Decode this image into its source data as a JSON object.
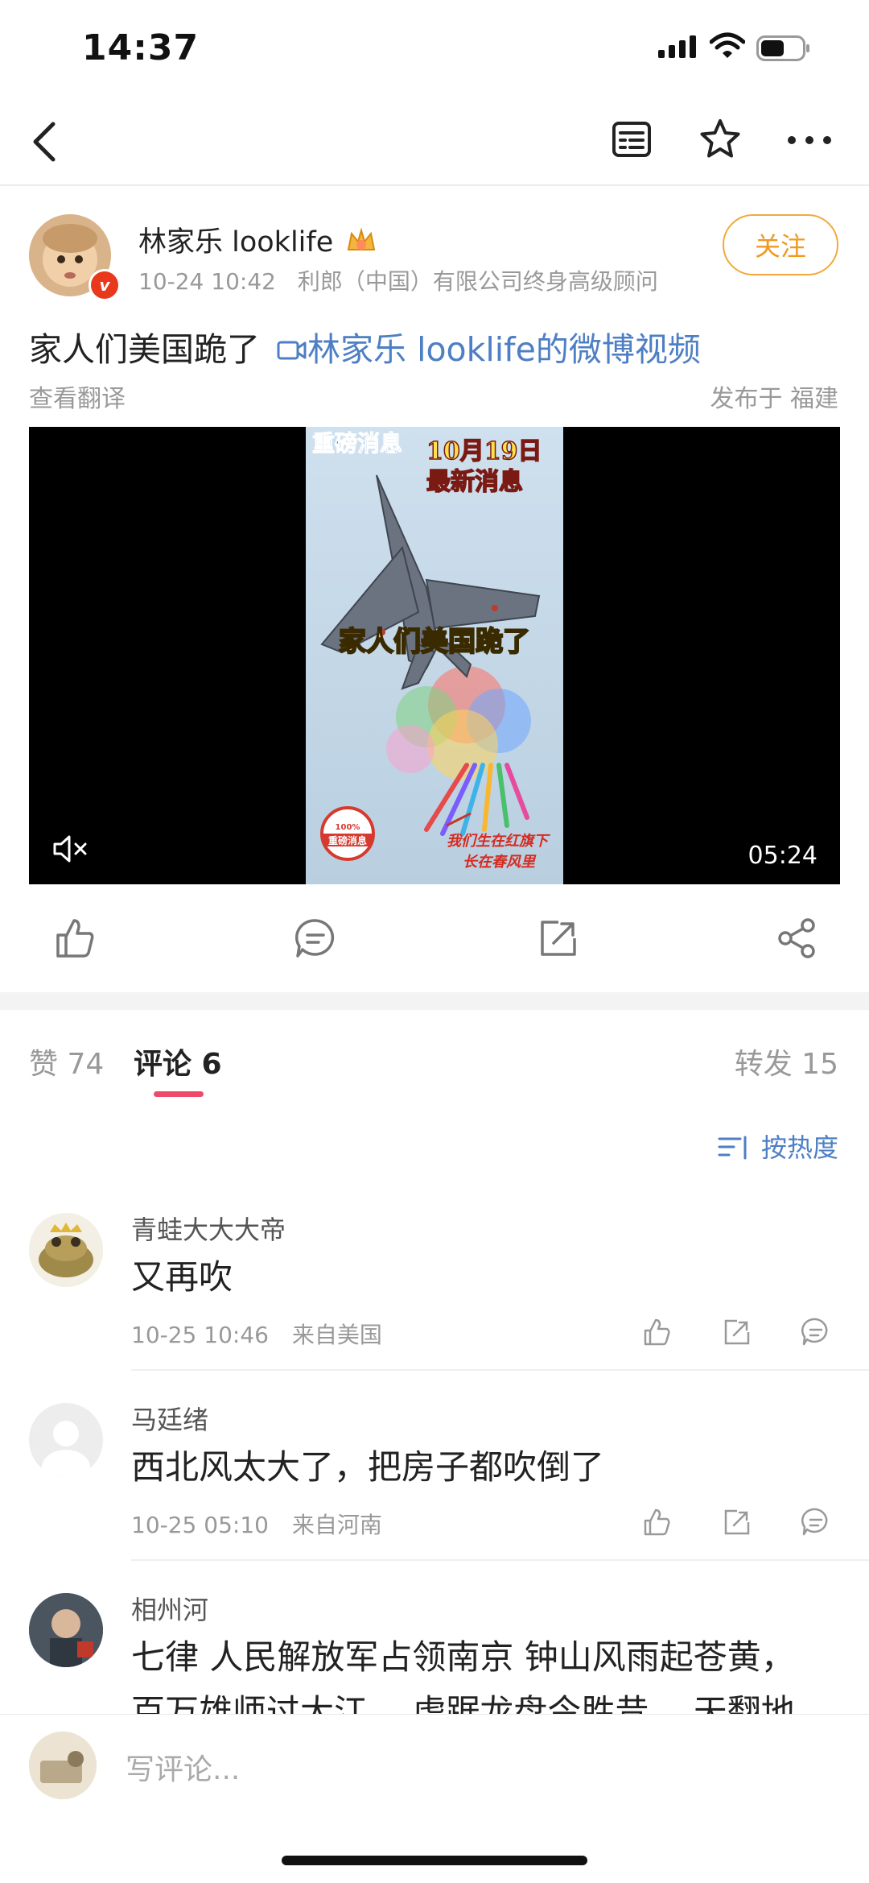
{
  "status_bar": {
    "time": "14:37"
  },
  "post": {
    "author_name": "林家乐 looklife",
    "date": "10-24 10:42",
    "author_title": "利郎（中国）有限公司终身高级顾问",
    "follow_label": "关注",
    "text": "家人们美国跪了",
    "video_link_label": "林家乐 looklife的微博视频",
    "translate_label": "查看翻译",
    "location": "发布于 福建"
  },
  "video": {
    "duration": "05:24",
    "banner_logo": "重磅消息",
    "banner_date": "10月19日",
    "banner_news": "最新消息",
    "caption": "家人们美国跪了",
    "stamp_percent": "100%",
    "stamp_label": "重磅消息",
    "slogan_line1": "我们生在红旗下",
    "slogan_line2": "长在春风里"
  },
  "tabs": {
    "likes": "赞 74",
    "comments": "评论 6",
    "reposts": "转发 15"
  },
  "sort_label": "按热度",
  "comments": [
    {
      "name": "青蛙大大大帝",
      "text": "又再吹",
      "date": "10-25 10:46",
      "location": "来自美国"
    },
    {
      "name": "马廷绪",
      "text": "西北风太大了，把房子都吹倒了",
      "date": "10-25 05:10",
      "location": "来自河南"
    },
    {
      "name": "相州河",
      "text": "七律 人民解放军占领南京 钟山风雨起苍黄，",
      "text2": "百万雄师过大江。 虎踞龙盘今胜昔， 天翻地"
    }
  ],
  "input_placeholder": "写评论..."
}
